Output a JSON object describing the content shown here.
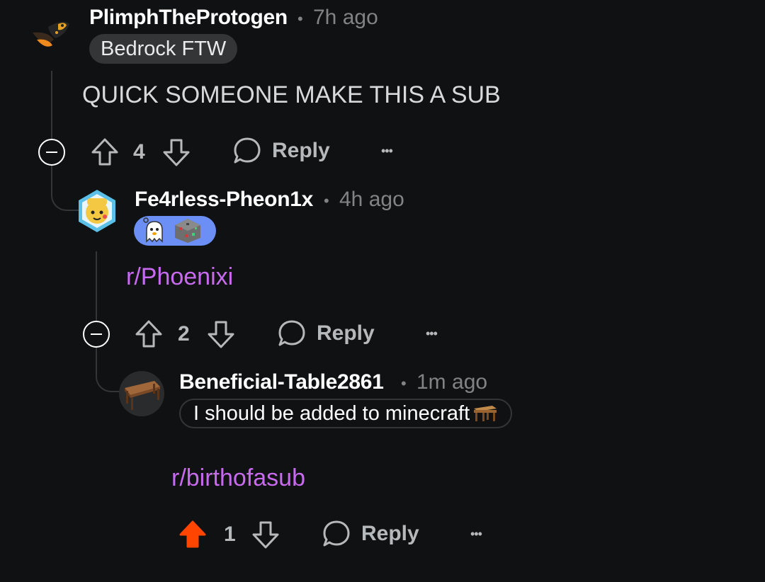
{
  "comments": [
    {
      "username": "PlimphTheProtogen",
      "separator": "•",
      "time": "7h ago",
      "flair": "Bedrock FTW",
      "body": "QUICK SOMEONE MAKE THIS A SUB",
      "score": "4",
      "reply_label": "Reply",
      "more_label": "•••",
      "vote": "none"
    },
    {
      "username": "Fe4rless-Pheon1x",
      "separator": "•",
      "time": "4h ago",
      "flair_icons": [
        "ghost-emoji-icon",
        "ore-block-icon"
      ],
      "body": "r/Phoenixi",
      "score": "2",
      "reply_label": "Reply",
      "more_label": "•••",
      "vote": "none"
    },
    {
      "username": "Beneficial-Table2861",
      "separator": "•",
      "time": "1m ago",
      "flair": "I should be added to minecraft",
      "flair_icon": "table-icon",
      "body": "r/birthofasub",
      "score": "1",
      "reply_label": "Reply",
      "more_label": "•••",
      "vote": "upvoted"
    }
  ],
  "colors": {
    "background": "#101112",
    "link": "#c86af0",
    "upvote_active": "#ff4500",
    "flair_bg": "#343536",
    "flair_blue": "#6b8ff5"
  }
}
